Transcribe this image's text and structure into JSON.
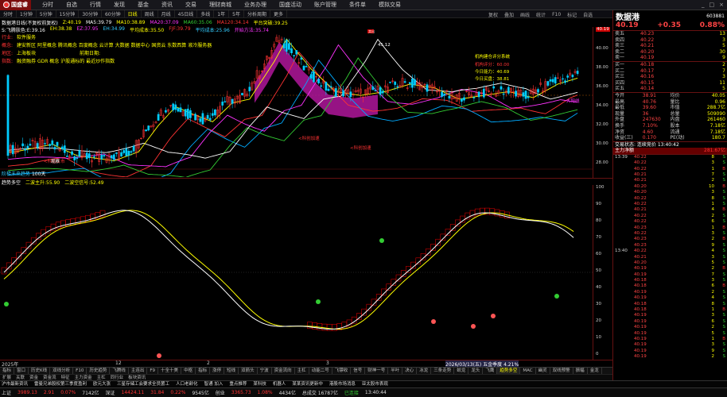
{
  "app": {
    "logo": "国盛睿",
    "menu": [
      "分时",
      "自选",
      "行情",
      "发现",
      "基金",
      "资讯",
      "交易",
      "理财商城",
      "业务办理",
      "国盛活动",
      "账户管理",
      "条件单",
      "模拟交易"
    ],
    "win": [
      "_",
      "□",
      "×"
    ]
  },
  "toolbar": {
    "items": [
      "分时",
      "1分钟",
      "5分钟",
      "15分钟",
      "30分钟",
      "60分钟",
      "日线",
      "周线",
      "月线",
      "45日线",
      "多线",
      "1年",
      "5年",
      "分析周期",
      "更多"
    ],
    "active": 6,
    "right": [
      "复权",
      "叠加",
      "画线",
      "统计",
      "F10",
      "标记",
      "自选"
    ]
  },
  "title": {
    "name": "数据港日线(不复权前复权)",
    "vals": [
      {
        "t": "Z:40.19",
        "c": "#ff0"
      },
      {
        "t": "MA5:39.79",
        "c": "#fff"
      },
      {
        "t": "MA10:38.89",
        "c": "#ff0"
      },
      {
        "t": "MA20:37.09",
        "c": "#f3f"
      },
      {
        "t": "MA60:35.06",
        "c": "#3c3"
      },
      {
        "t": "MA120:34.14",
        "c": "#f33"
      },
      {
        "t": "平台突破:39.25",
        "c": "#ff0"
      }
    ],
    "platform": "量能平台:39.25"
  },
  "maline": [
    {
      "t": "S:飞腾肤色:E:39.16",
      "c": "#fff"
    },
    {
      "t": "EH:38.38",
      "c": "#ff0"
    },
    {
      "t": "EZ:37.95",
      "c": "#f3f"
    },
    {
      "t": "EH:34.99",
      "c": "#3cf"
    },
    {
      "t": "平均成本:35.50",
      "c": "#ff0"
    },
    {
      "t": "FJF:39.79",
      "c": "#f33"
    },
    {
      "t": "平均成本:25.96",
      "c": "#3cf"
    },
    {
      "t": "开始方法:35.74",
      "c": "#f3f"
    }
  ],
  "stickers": [
    {
      "k": "行业:",
      "v": "软件服务",
      "kc": "#f33",
      "vc": "#ff0"
    },
    {
      "k": "概念:",
      "v": "建安新区 阿里概念 腾讯概念 百度概念 云计算 大数据 数据中心 国资云 东数西算 液冷服务器",
      "kc": "#f33",
      "vc": "#ff0"
    },
    {
      "k": "地区:",
      "v": "上海板块",
      "kc": "#f33",
      "vc": "#ff0",
      "x": "前期日期:"
    },
    {
      "k": "指数:",
      "v": "融资融券 GDR 概念 沪股通标的 最近炒作指数",
      "kc": "#f33",
      "vc": "#ff0"
    }
  ],
  "annot": {
    "high": "45.12",
    "low": "28.51",
    "btn1": "机构建仓评分系统",
    "btn2": "机构评分：60.00",
    "btn3": "今日能力：40.69",
    "btn4": "今日买盘：38.81",
    "sell": "卖出",
    "buy1": "大阳线",
    "buy2": "大阳线",
    "start": "启动",
    "watch": "观察",
    "redtext1": "<科创上市",
    "redtext2": "<科创加速",
    "redtext3": "<科创加速"
  },
  "yaxis": [
    "40.19",
    "40.00",
    "38.00",
    "36.00",
    "34.00",
    "32.00",
    "30.00",
    "28.00"
  ],
  "mid": {
    "label": "阶梯未来趋势",
    "label2": "100天"
  },
  "ind": {
    "name": "趋势多空",
    "a": "二波主升:55.90",
    "b": "二波空信号:52.49"
  },
  "yaxis2": [
    "100",
    "90",
    "80",
    "70",
    "60",
    "50",
    "40",
    "30",
    "20",
    "10",
    "0"
  ],
  "dates": [
    "2025年",
    "12",
    "2",
    "3",
    "2026/03/13(五) 五金季度 4.21%"
  ],
  "btabs": [
    "指标",
    "窗口",
    "历史K线",
    "双线分析",
    "F10",
    "历史趋势",
    "飞腾线",
    "主连出",
    "F9",
    "十全十美",
    "中枢",
    "指标",
    "涨停",
    "短线",
    "双箭头",
    "宁波",
    "资金流向",
    "主杠",
    "动能二号",
    "飞镖收",
    "信号",
    "财神一号",
    "半叶",
    "决心",
    "冰龙",
    "三条走势",
    "蛟龙",
    "龙头",
    "飞鹰",
    "趋势多空",
    "MAC",
    "幽灵",
    "双线预警",
    "振幅",
    "金龙"
  ],
  "btabs_active": 29,
  "btabs2": [
    "扩展",
    "关联",
    "资金",
    "资金流",
    "特征",
    "主力资金",
    "主杠",
    "同行业",
    "板块资讯"
  ],
  "ticker": [
    "沪市最新资讯",
    "雷曼兄弟股权第三季度盈利",
    "欧元大涨",
    "三星存储工会要求全员罢工",
    "人口老龄化",
    "智通 加入",
    "重点推荐",
    "某科技",
    "机器人",
    "某某资讯更新中",
    "港股市场消息",
    "亚太股市表现"
  ],
  "status": [
    {
      "t": "上证",
      "c": "#ddd"
    },
    {
      "t": "3989.13",
      "c": "#f33"
    },
    {
      "t": "2.91",
      "c": "#f33"
    },
    {
      "t": "0.07%",
      "c": "#f33"
    },
    {
      "t": "7142亿",
      "c": "#ddd"
    },
    {
      "t": "深证",
      "c": "#ddd"
    },
    {
      "t": "14424.11",
      "c": "#f33"
    },
    {
      "t": "31.84",
      "c": "#f33"
    },
    {
      "t": "0.22%",
      "c": "#f33"
    },
    {
      "t": "9545亿",
      "c": "#ddd"
    },
    {
      "t": "创业",
      "c": "#ddd"
    },
    {
      "t": "3365.73",
      "c": "#f33"
    },
    {
      "t": "1.08%",
      "c": "#f33"
    },
    {
      "t": "4434亿",
      "c": "#ddd"
    },
    {
      "t": "总成交 16787亿",
      "c": "#ddd"
    },
    {
      "t": "已连接",
      "c": "#3c3"
    },
    {
      "t": "13:40:44",
      "c": "#ddd"
    }
  ],
  "quote": {
    "name": "数据港",
    "code": "603881",
    "price": "40.19",
    "change": "+0.35",
    "pct": "0.88%"
  },
  "asks": [
    {
      "l": "卖五",
      "p": "40.23",
      "v": "13"
    },
    {
      "l": "卖四",
      "p": "40.22",
      "v": "3"
    },
    {
      "l": "卖三",
      "p": "40.21",
      "v": "5"
    },
    {
      "l": "卖二",
      "p": "40.20",
      "v": "30"
    },
    {
      "l": "卖一",
      "p": "40.19",
      "v": "9"
    }
  ],
  "bids": [
    {
      "l": "买一",
      "p": "40.18",
      "v": "2"
    },
    {
      "l": "买二",
      "p": "40.17",
      "v": "7"
    },
    {
      "l": "买三",
      "p": "40.16",
      "v": "3"
    },
    {
      "l": "买四",
      "p": "40.15",
      "v": "11"
    },
    {
      "l": "买五",
      "p": "40.14",
      "v": "5"
    }
  ],
  "stats": [
    [
      "今开",
      "38.91",
      "均价",
      "40.05"
    ],
    [
      "最高",
      "40.76",
      "量比",
      "0.96"
    ],
    [
      "最低",
      "39.60",
      "市值",
      "288.7亿"
    ],
    [
      "现量",
      "36",
      "总量",
      "509090"
    ],
    [
      "外盘",
      "247630",
      "内盘",
      "261460"
    ],
    [
      "换手",
      "7.10%",
      "股本",
      "7.18亿"
    ],
    [
      "净资",
      "4.60",
      "流通",
      "7.18亿"
    ],
    [
      "收益(三)",
      "0.170",
      "PE(动)",
      "180.7"
    ]
  ],
  "tradestate": {
    "a": "交易状态: 连续竞价 13:40:42",
    "b": "主力净额",
    "c": "281.67亿"
  },
  "ticks": [
    [
      "13:39",
      "40.22",
      "8",
      "S"
    ],
    [
      "",
      "40.22",
      "3",
      "S"
    ],
    [
      "",
      "40.22",
      "1",
      "B"
    ],
    [
      "",
      "40.21",
      "7",
      "S"
    ],
    [
      "",
      "40.21",
      "2",
      "S"
    ],
    [
      "",
      "40.20",
      "10",
      "B"
    ],
    [
      "",
      "40.20",
      "3",
      "S"
    ],
    [
      "",
      "40.22",
      "8",
      "S"
    ],
    [
      "",
      "40.22",
      "1",
      "S"
    ],
    [
      "",
      "40.21",
      "4",
      "B"
    ],
    [
      "",
      "40.22",
      "2",
      "S"
    ],
    [
      "",
      "40.22",
      "6",
      "S"
    ],
    [
      "",
      "40.23",
      "1",
      "B"
    ],
    [
      "",
      "40.22",
      "3",
      "S"
    ],
    [
      "",
      "40.23",
      "2",
      "B"
    ],
    [
      "",
      "40.23",
      "9",
      "S"
    ],
    [
      "13:40",
      "40.22",
      "4",
      "S"
    ],
    [
      "",
      "40.21",
      "3",
      "S"
    ],
    [
      "",
      "40.20",
      "5",
      "S"
    ],
    [
      "",
      "40.19",
      "2",
      "B"
    ],
    [
      "",
      "40.19",
      "7",
      "S"
    ],
    [
      "",
      "40.18",
      "3",
      "S"
    ],
    [
      "",
      "40.18",
      "6",
      "B"
    ],
    [
      "",
      "40.19",
      "2",
      "S"
    ],
    [
      "",
      "40.19",
      "4",
      "S"
    ],
    [
      "",
      "40.18",
      "8",
      "S"
    ],
    [
      "",
      "40.18",
      "1",
      "B"
    ],
    [
      "",
      "40.19",
      "3",
      "S"
    ],
    [
      "",
      "40.19",
      "6",
      "S"
    ],
    [
      "",
      "40.19",
      "2",
      "S"
    ],
    [
      "",
      "40.19",
      "5",
      "S"
    ],
    [
      "",
      "40.19",
      "1",
      "B"
    ],
    [
      "",
      "40.19",
      "3",
      "S"
    ],
    [
      "",
      "40.19",
      "9",
      "S"
    ],
    [
      "",
      "40.19",
      "2",
      "S"
    ]
  ],
  "rbottom": {
    "a": "指标",
    "b": "更多"
  },
  "colors": {
    "bull": "#ff3333",
    "bear": "#00ccff",
    "grid": "#661111"
  }
}
